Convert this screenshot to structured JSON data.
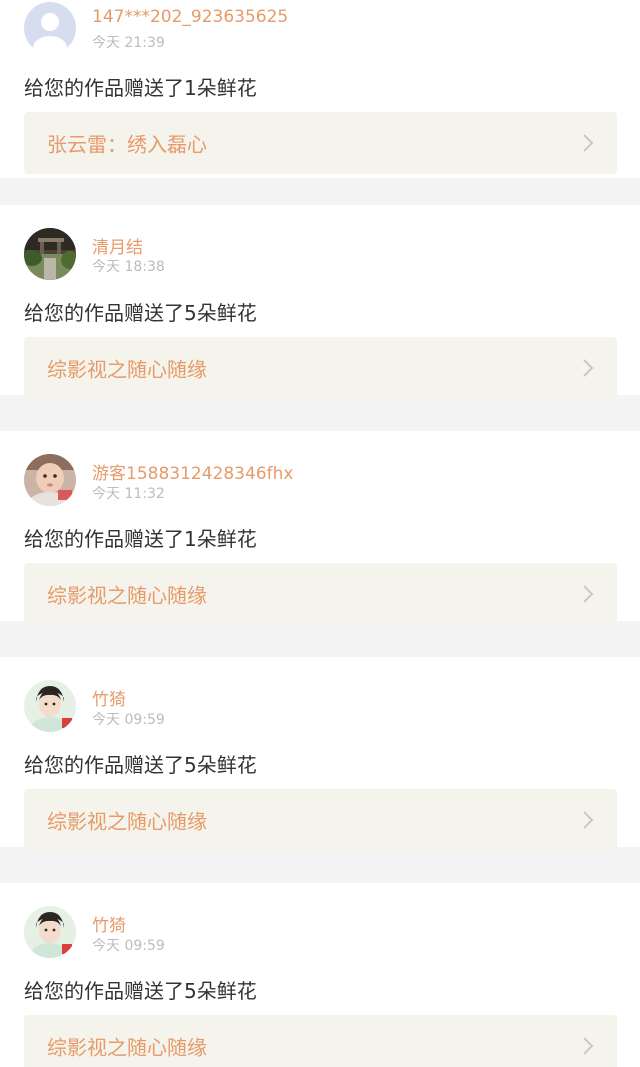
{
  "notifications": [
    {
      "username": "147***202_923635625",
      "time": "今天 21:39",
      "message": "给您的作品赠送了1朵鲜花",
      "work_title": "张云雷：绣入磊心",
      "avatar_icon": "default-avatar-icon"
    },
    {
      "username": "清月结",
      "time": "今天 18:38",
      "message": "给您的作品赠送了5朵鲜花",
      "work_title": "综影视之随心随缘",
      "avatar_icon": "landscape-photo-avatar"
    },
    {
      "username": "游客1588312428346fhx",
      "time": "今天 11:32",
      "message": "给您的作品赠送了1朵鲜花",
      "work_title": "综影视之随心随缘",
      "avatar_icon": "baby-photo-avatar"
    },
    {
      "username": "竹猗",
      "time": "今天 09:59",
      "message": "给您的作品赠送了5朵鲜花",
      "work_title": "综影视之随心随缘",
      "avatar_icon": "portrait-photo-avatar"
    },
    {
      "username": "竹猗",
      "time": "今天 09:59",
      "message": "给您的作品赠送了5朵鲜花",
      "work_title": "综影视之随心随缘",
      "avatar_icon": "portrait-photo-avatar"
    }
  ],
  "colors": {
    "accent": "#e79a6a",
    "link_background": "#f5f4ec",
    "page_background": "#f4f4f4",
    "card_background": "#ffffff",
    "time_text": "#bcbcbc",
    "message_text": "#333333"
  }
}
